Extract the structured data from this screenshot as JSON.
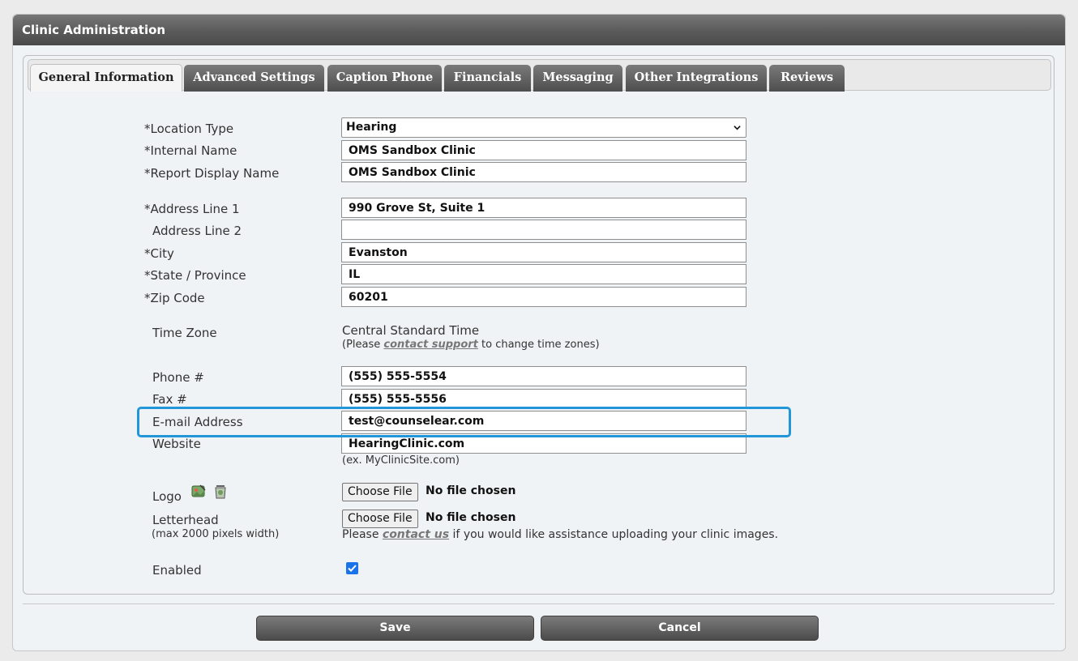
{
  "header": {
    "title": "Clinic Administration"
  },
  "tabs": [
    {
      "label": "General Information",
      "active": true
    },
    {
      "label": "Advanced Settings"
    },
    {
      "label": "Caption Phone"
    },
    {
      "label": "Financials"
    },
    {
      "label": "Messaging"
    },
    {
      "label": "Other Integrations"
    },
    {
      "label": "Reviews"
    }
  ],
  "form": {
    "location_type": {
      "label": "*Location Type",
      "value": "Hearing"
    },
    "internal_name": {
      "label": "*Internal Name",
      "value": "OMS Sandbox Clinic"
    },
    "report_display_name": {
      "label": "*Report Display Name",
      "value": "OMS Sandbox Clinic"
    },
    "address1": {
      "label": "*Address Line 1",
      "value": "990 Grove St, Suite 1"
    },
    "address2": {
      "label": "Address Line 2",
      "value": ""
    },
    "city": {
      "label": "*City",
      "value": "Evanston"
    },
    "state": {
      "label": "*State / Province",
      "value": "IL"
    },
    "zip": {
      "label": "*Zip Code",
      "value": "60201"
    },
    "time_zone": {
      "label": "Time Zone",
      "value": "Central Standard Time",
      "note_prefix": "(Please ",
      "note_link": "contact support",
      "note_suffix": " to change time zones)"
    },
    "phone": {
      "label": "Phone #",
      "value": "(555) 555-5554"
    },
    "fax": {
      "label": "Fax #",
      "value": "(555) 555-5556"
    },
    "email": {
      "label": "E-mail Address",
      "value": "test@counselear.com"
    },
    "website": {
      "label": "Website",
      "value": "HearingClinic.com",
      "hint": "(ex. MyClinicSite.com)"
    },
    "logo": {
      "label": "Logo",
      "button": "Choose File",
      "status": "No file chosen"
    },
    "letterhead": {
      "label": "Letterhead",
      "hint": "(max 2000 pixels width)",
      "button": "Choose File",
      "status": "No file chosen",
      "note_prefix": "Please ",
      "note_link": "contact us",
      "note_suffix": " if you would like assistance uploading your clinic images."
    },
    "enabled": {
      "label": "Enabled",
      "checked": true
    }
  },
  "actions": {
    "save": "Save",
    "cancel": "Cancel"
  },
  "icons": {
    "logo_edit": "image-edit-icon",
    "logo_delete": "trash-icon"
  },
  "colors": {
    "highlight": "#2196d8",
    "header_dark": "#4a4a4a",
    "checkbox": "#1a73e8"
  }
}
